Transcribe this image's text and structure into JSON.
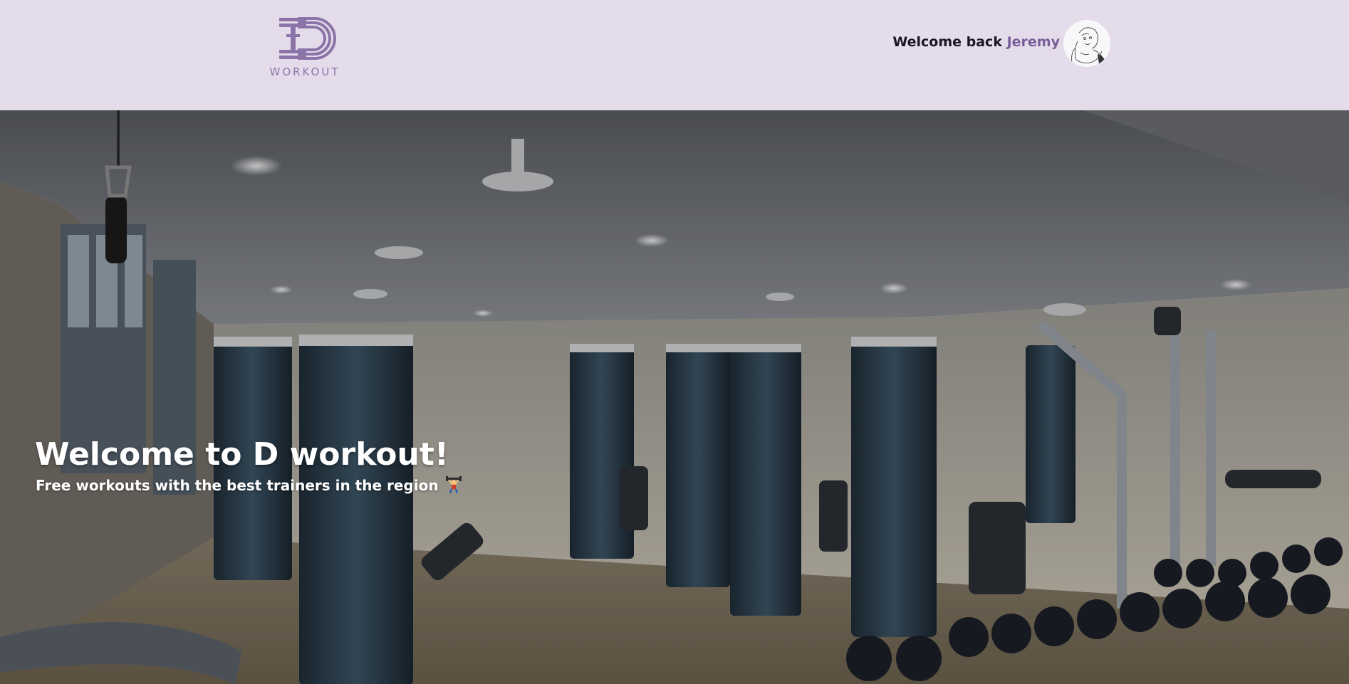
{
  "header": {
    "logo": {
      "wordmark": "WORKOUT",
      "icon": "d-dumbbell-logo-icon"
    },
    "welcome_prefix": "Welcome back",
    "user_name": "Jeremy",
    "avatar_icon": "gorilla-sketch-avatar"
  },
  "hero": {
    "background": "gym-interior-photo",
    "title": "Welcome to D workout!",
    "subtitle": "Free workouts with the best trainers in the region",
    "subtitle_icon": "weightlifter-emoji-icon"
  },
  "colors": {
    "header_bg": "#e4dcea",
    "accent": "#7a5e98",
    "logo": "#8d74a8",
    "text_dark": "#1b1424",
    "hero_text": "#ffffff"
  }
}
